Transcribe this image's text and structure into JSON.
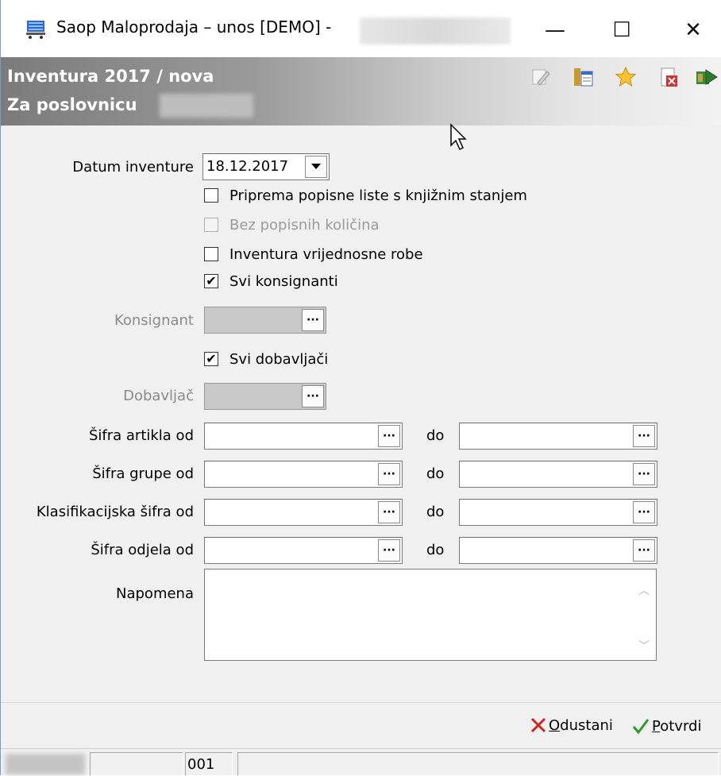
{
  "window": {
    "title": "Saop Maloprodaja – unos [DEMO] -",
    "minimize": "—",
    "maximize": "☐",
    "close": "✕"
  },
  "header": {
    "title": "Inventura 2017 / nova",
    "subtitle": "Za poslovnicu",
    "toolbar": [
      "edit-icon",
      "columns-icon",
      "star-icon",
      "delete-icon",
      "exit-icon"
    ]
  },
  "form": {
    "datum_label": "Datum inventure",
    "datum_value": "18.12.2017",
    "checkboxes": [
      {
        "label": "Priprema popisne liste s knjižnim stanjem",
        "checked": false,
        "enabled": true
      },
      {
        "label": "Bez popisnih količina",
        "checked": false,
        "enabled": false
      },
      {
        "label": "Inventura vrijednosne robe",
        "checked": false,
        "enabled": true
      },
      {
        "label": "Svi konsignanti",
        "checked": true,
        "enabled": true
      }
    ],
    "konsignant_label": "Konsignant",
    "svi_dobavljaci_label": "Svi dobavljači",
    "dobavljac_label": "Dobavljač",
    "ranges": [
      {
        "label": "Šifra artikla od",
        "to": "do",
        "from_value": "",
        "to_value": ""
      },
      {
        "label": "Šifra grupe od",
        "to": "do",
        "from_value": "",
        "to_value": ""
      },
      {
        "label": "Klasifikacijska šifra od",
        "to": "do",
        "from_value": "",
        "to_value": ""
      },
      {
        "label": "Šifra odjela od",
        "to": "do",
        "from_value": "",
        "to_value": ""
      }
    ],
    "napomena_label": "Napomena",
    "napomena_value": "",
    "lookup_button": "···"
  },
  "actions": {
    "cancel_label": "Odustani",
    "cancel_key": "O",
    "cancel_rest": "dustani",
    "confirm_key": "P",
    "confirm_rest": "otvrdi"
  },
  "statusbar": {
    "code": "001"
  },
  "colors": {
    "cancel_icon": "#d42020",
    "confirm_icon": "#2e9a2e",
    "header_dark": "#7b7b7b"
  }
}
